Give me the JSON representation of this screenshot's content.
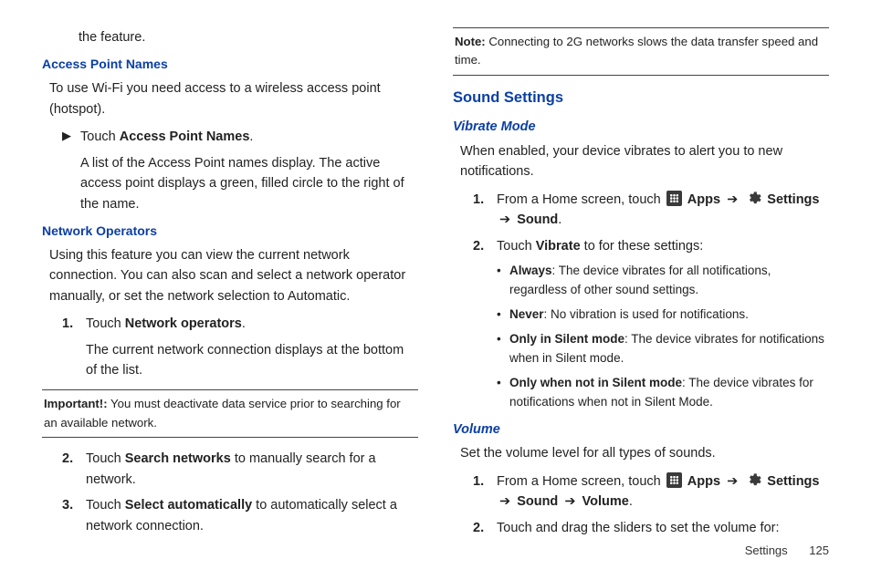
{
  "left": {
    "top_fragment": "the feature.",
    "apn": {
      "heading": "Access Point Names",
      "intro": "To use Wi-Fi you need access to a wireless access point (hotspot).",
      "step_pre": "Touch ",
      "step_bold": "Access Point Names",
      "step_post": ".",
      "desc": "A list of the Access Point names display. The active access point displays a green, filled circle to the right of the name."
    },
    "netops": {
      "heading": "Network Operators",
      "intro": "Using this feature you can view the current network connection. You can also scan and select a network operator manually, or set the network selection to Automatic.",
      "step1_pre": "Touch ",
      "step1_bold": "Network operators",
      "step1_post": ".",
      "step1_desc": "The current network connection displays at the bottom of the list.",
      "important_label": "Important!:",
      "important_text": " You must deactivate data service prior to searching for an available network.",
      "step2_pre": "Touch ",
      "step2_bold": "Search networks",
      "step2_post": " to manually search for a network.",
      "step3_pre": "Touch ",
      "step3_bold": "Select automatically",
      "step3_post": " to automatically select a network connection."
    }
  },
  "right": {
    "note_label": "Note:",
    "note_text": " Connecting to 2G networks slows the data transfer speed and time.",
    "sound_heading": "Sound Settings",
    "vibrate": {
      "heading": "Vibrate Mode",
      "intro": "When enabled, your device vibrates to alert you to new notifications.",
      "step1_pre": "From a Home screen, touch ",
      "apps_label": "Apps",
      "arrow": "➔",
      "settings_label": "Settings",
      "sound_label": "Sound",
      "step2_pre": "Touch ",
      "step2_bold": "Vibrate",
      "step2_post": " to for these settings:",
      "bullets": [
        {
          "b": "Always",
          "t": ": The device vibrates for all notifications, regardless of other sound settings."
        },
        {
          "b": "Never",
          "t": ": No vibration is used for notifications."
        },
        {
          "b": "Only in Silent mode",
          "t": ": The device vibrates for notifications when in Silent mode."
        },
        {
          "b": "Only when not in Silent mode",
          "t": ": The device vibrates for notifications when not in Silent Mode."
        }
      ]
    },
    "volume": {
      "heading": "Volume",
      "intro": "Set the volume level for all types of sounds.",
      "step1_pre": "From a Home screen, touch ",
      "apps_label": "Apps",
      "arrow": "➔",
      "settings_label": "Settings",
      "sound_label": "Sound",
      "volume_label": "Volume",
      "step2": "Touch and drag the sliders to set the volume for:"
    }
  },
  "footer": {
    "section": "Settings",
    "page": "125"
  },
  "ol_nums": {
    "n1": "1.",
    "n2": "2.",
    "n3": "3."
  },
  "glyphs": {
    "tri": "▶",
    "dot": "•"
  }
}
